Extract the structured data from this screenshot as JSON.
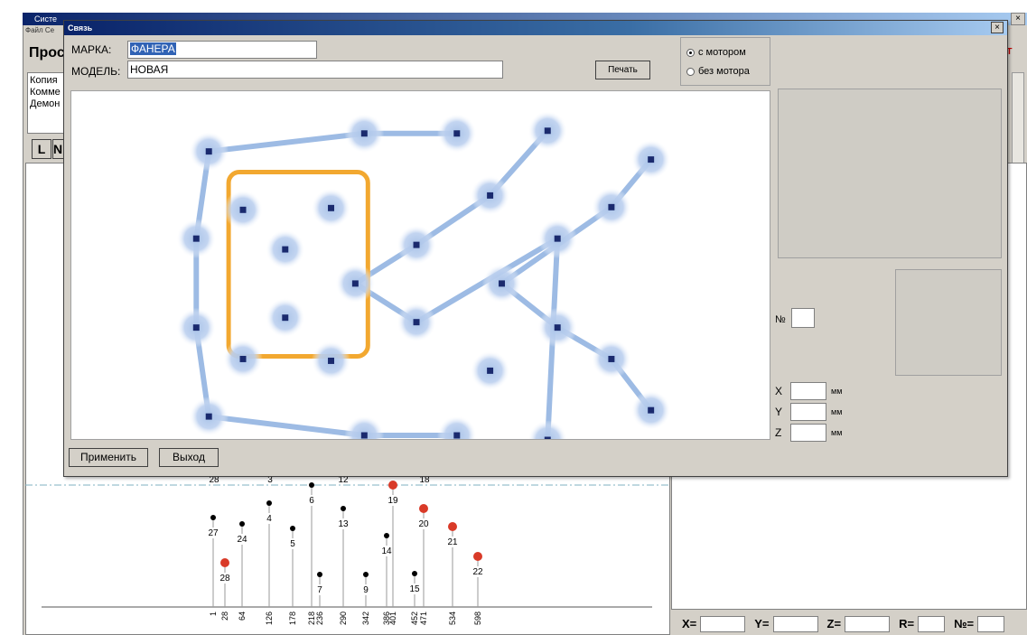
{
  "background": {
    "app_title": "Систе",
    "menu": "Файл  Се",
    "heading": "Прос",
    "notes": [
      "Копия",
      "Комме",
      "Демон"
    ],
    "btn_l": "L",
    "btn_n": "N",
    "red_button": "КТ",
    "close": "×",
    "top_labels": [
      "28",
      "3",
      "12",
      "18"
    ],
    "bottom_bar": {
      "x_label": "X=",
      "y_label": "Y=",
      "z_label": "Z=",
      "r_label": "R=",
      "n_label": "№="
    }
  },
  "stems": [
    {
      "label": "27",
      "pos": "1",
      "red": false
    },
    {
      "label": "28",
      "pos": "28",
      "red": true
    },
    {
      "label": "24",
      "pos": "64",
      "red": false
    },
    {
      "label": "4",
      "pos": "126",
      "red": false
    },
    {
      "label": "5",
      "pos": "178",
      "red": false
    },
    {
      "label": "6",
      "pos": "218",
      "red": false
    },
    {
      "label": "7",
      "pos": "236",
      "red": false
    },
    {
      "label": "13",
      "pos": "290",
      "red": false
    },
    {
      "label": "9",
      "pos": "342",
      "red": false
    },
    {
      "label": "14",
      "pos": "386",
      "red": false
    },
    {
      "label": "19",
      "pos": "401",
      "red": true
    },
    {
      "label": "15",
      "pos": "452",
      "red": false
    },
    {
      "label": "20",
      "pos": "471",
      "red": true
    },
    {
      "label": "21",
      "pos": "534",
      "red": true
    },
    {
      "label": "22",
      "pos": "598",
      "red": true
    }
  ],
  "dialog": {
    "title": "Связь",
    "close": "×",
    "marka_label": "МАРКА:",
    "marka_value": "ФАНЕРА",
    "model_label": "МОДЕЛЬ:",
    "model_value": "НОВАЯ",
    "print_button": "Печать",
    "motor_options": [
      {
        "label": "с мотором",
        "checked": true
      },
      {
        "label": "без мотора",
        "checked": false
      }
    ],
    "num_label": "№",
    "coords": [
      {
        "axis": "X",
        "unit": "мм"
      },
      {
        "axis": "Y",
        "unit": "мм"
      },
      {
        "axis": "Z",
        "unit": "мм"
      }
    ],
    "apply_button": "Применить",
    "exit_button": "Выход"
  },
  "colors": {
    "node_glow": "#a9c3e8",
    "connector": "#9dbbe4",
    "node_core": "#1a2a6e",
    "selection": "#f2a830",
    "stem_red": "#d93a28"
  }
}
